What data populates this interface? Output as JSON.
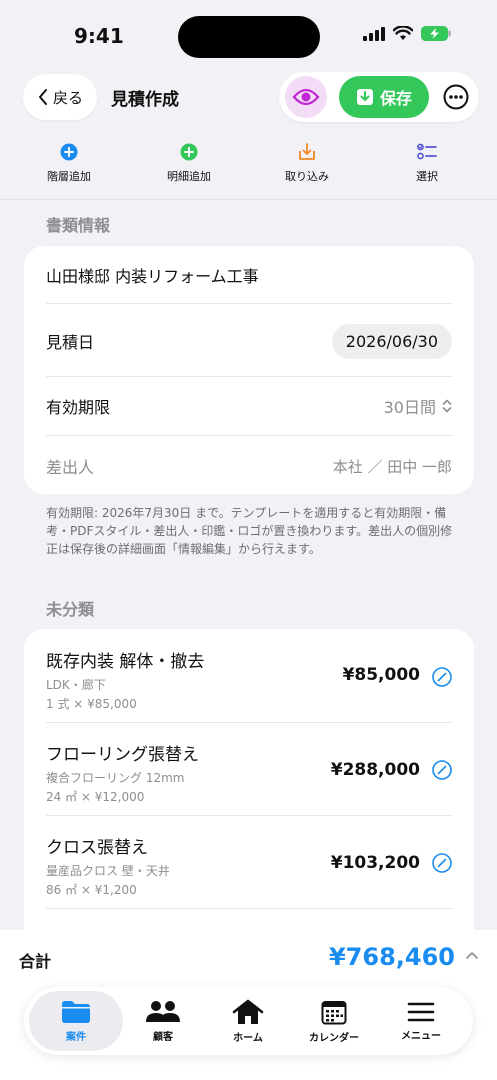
{
  "status": {
    "time": "9:41"
  },
  "header": {
    "back_label": "戻る",
    "title": "見積作成",
    "save_label": "保存"
  },
  "toolbar": {
    "items": [
      {
        "label": "階層追加",
        "icon": "plus-circle-icon",
        "color": "#1a8cf0"
      },
      {
        "label": "明細追加",
        "icon": "plus-circle-icon",
        "color": "#34c759"
      },
      {
        "label": "取り込み",
        "icon": "import-icon",
        "color": "#f08a24"
      },
      {
        "label": "選択",
        "icon": "checklist-icon",
        "color": "#5856d6"
      }
    ]
  },
  "document_info": {
    "section_title": "書類情報",
    "project_name": "山田様邸 内装リフォーム工事",
    "estimate_date_label": "見積日",
    "estimate_date": "2026/06/30",
    "validity_label": "有効期限",
    "validity_value": "30日間",
    "sender_label": "差出人",
    "sender_value": "本社 ／ 田中 一郎",
    "note": "有効期限: 2026年7月30日 まで。テンプレートを適用すると有効期限・備考・PDFスタイル・差出人・印鑑・ロゴが置き換わります。差出人の個別修正は保存後の詳細画面「情報編集」から行えます。"
  },
  "uncategorized": {
    "section_title": "未分類",
    "items": [
      {
        "title": "既存内装 解体・撤去",
        "sub1": "LDK・廊下",
        "sub2": "1 式 × ¥85,000",
        "price": "¥85,000"
      },
      {
        "title": "フローリング張替え",
        "sub1": "複合フローリング 12mm",
        "sub2": "24 ㎡ × ¥12,000",
        "price": "¥288,000"
      },
      {
        "title": "クロス張替え",
        "sub1": "量産品クロス 壁・天井",
        "sub2": "86 ㎡ × ¥1,200",
        "price": "¥103,200"
      }
    ]
  },
  "total": {
    "label": "合計",
    "value": "¥768,460"
  },
  "tabbar": {
    "items": [
      {
        "label": "案件",
        "icon": "folder-icon",
        "active": true
      },
      {
        "label": "顧客",
        "icon": "people-icon",
        "active": false
      },
      {
        "label": "ホーム",
        "icon": "home-icon",
        "active": false
      },
      {
        "label": "カレンダー",
        "icon": "calendar-icon",
        "active": false
      },
      {
        "label": "メニュー",
        "icon": "menu-icon",
        "active": false
      }
    ]
  },
  "colors": {
    "accent": "#1a8cf0",
    "save": "#34c759",
    "preview": "#c026d3"
  }
}
